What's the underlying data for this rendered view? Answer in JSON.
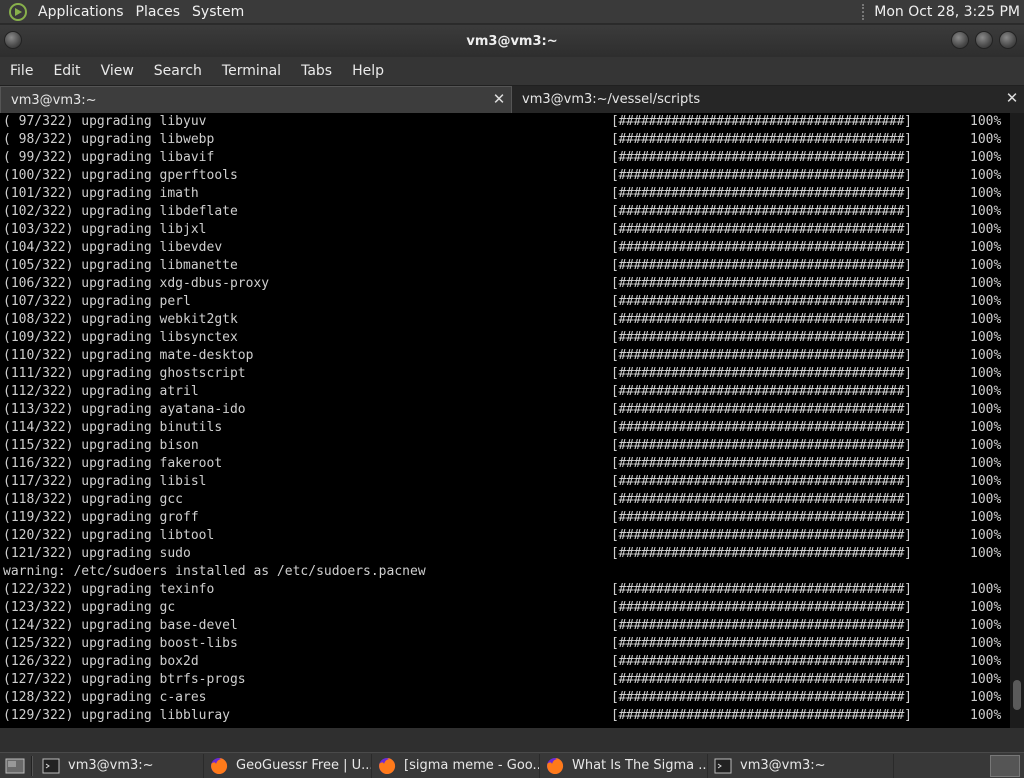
{
  "top_panel": {
    "menus": [
      "Applications",
      "Places",
      "System"
    ],
    "clock": "Mon Oct 28,  3:25 PM"
  },
  "window": {
    "title": "vm3@vm3:~"
  },
  "menubar": {
    "items": [
      "File",
      "Edit",
      "View",
      "Search",
      "Terminal",
      "Tabs",
      "Help"
    ]
  },
  "tabs": [
    {
      "label": "vm3@vm3:~",
      "active": true
    },
    {
      "label": "vm3@vm3:~/vessel/scripts",
      "active": false
    }
  ],
  "terminal": {
    "progress_bar": "[######################################]",
    "lines": [
      {
        "text": "( 97/322) upgrading libyuv",
        "percent": "100%"
      },
      {
        "text": "( 98/322) upgrading libwebp",
        "percent": "100%"
      },
      {
        "text": "( 99/322) upgrading libavif",
        "percent": "100%"
      },
      {
        "text": "(100/322) upgrading gperftools",
        "percent": "100%"
      },
      {
        "text": "(101/322) upgrading imath",
        "percent": "100%"
      },
      {
        "text": "(102/322) upgrading libdeflate",
        "percent": "100%"
      },
      {
        "text": "(103/322) upgrading libjxl",
        "percent": "100%"
      },
      {
        "text": "(104/322) upgrading libevdev",
        "percent": "100%"
      },
      {
        "text": "(105/322) upgrading libmanette",
        "percent": "100%"
      },
      {
        "text": "(106/322) upgrading xdg-dbus-proxy",
        "percent": "100%"
      },
      {
        "text": "(107/322) upgrading perl",
        "percent": "100%"
      },
      {
        "text": "(108/322) upgrading webkit2gtk",
        "percent": "100%"
      },
      {
        "text": "(109/322) upgrading libsynctex",
        "percent": "100%"
      },
      {
        "text": "(110/322) upgrading mate-desktop",
        "percent": "100%"
      },
      {
        "text": "(111/322) upgrading ghostscript",
        "percent": "100%"
      },
      {
        "text": "(112/322) upgrading atril",
        "percent": "100%"
      },
      {
        "text": "(113/322) upgrading ayatana-ido",
        "percent": "100%"
      },
      {
        "text": "(114/322) upgrading binutils",
        "percent": "100%"
      },
      {
        "text": "(115/322) upgrading bison",
        "percent": "100%"
      },
      {
        "text": "(116/322) upgrading fakeroot",
        "percent": "100%"
      },
      {
        "text": "(117/322) upgrading libisl",
        "percent": "100%"
      },
      {
        "text": "(118/322) upgrading gcc",
        "percent": "100%"
      },
      {
        "text": "(119/322) upgrading groff",
        "percent": "100%"
      },
      {
        "text": "(120/322) upgrading libtool",
        "percent": "100%"
      },
      {
        "text": "(121/322) upgrading sudo",
        "percent": "100%"
      },
      {
        "text": "warning: /etc/sudoers installed as /etc/sudoers.pacnew",
        "percent": null
      },
      {
        "text": "(122/322) upgrading texinfo",
        "percent": "100%"
      },
      {
        "text": "(123/322) upgrading gc",
        "percent": "100%"
      },
      {
        "text": "(124/322) upgrading base-devel",
        "percent": "100%"
      },
      {
        "text": "(125/322) upgrading boost-libs",
        "percent": "100%"
      },
      {
        "text": "(126/322) upgrading box2d",
        "percent": "100%"
      },
      {
        "text": "(127/322) upgrading btrfs-progs",
        "percent": "100%"
      },
      {
        "text": "(128/322) upgrading c-ares",
        "percent": "100%"
      },
      {
        "text": "(129/322) upgrading libbluray",
        "percent": "100%"
      }
    ],
    "scroll_position": 0.97,
    "scroll_visible_fraction": 0.05
  },
  "taskbar": {
    "tasks": [
      {
        "label": "vm3@vm3:~",
        "icon": "terminal-icon"
      },
      {
        "label": "GeoGuessr Free | U...",
        "icon": "firefox-icon"
      },
      {
        "label": "[sigma meme - Goo...",
        "icon": "firefox-icon"
      },
      {
        "label": "What Is The Sigma ...",
        "icon": "firefox-icon"
      },
      {
        "label": "vm3@vm3:~",
        "icon": "terminal-icon"
      }
    ]
  },
  "colors": {
    "terminal_bg": "#000000",
    "terminal_fg": "#cfcfcf",
    "panel_bg": "#3a3a3a",
    "firefox_orange": "#ff7a1a"
  }
}
